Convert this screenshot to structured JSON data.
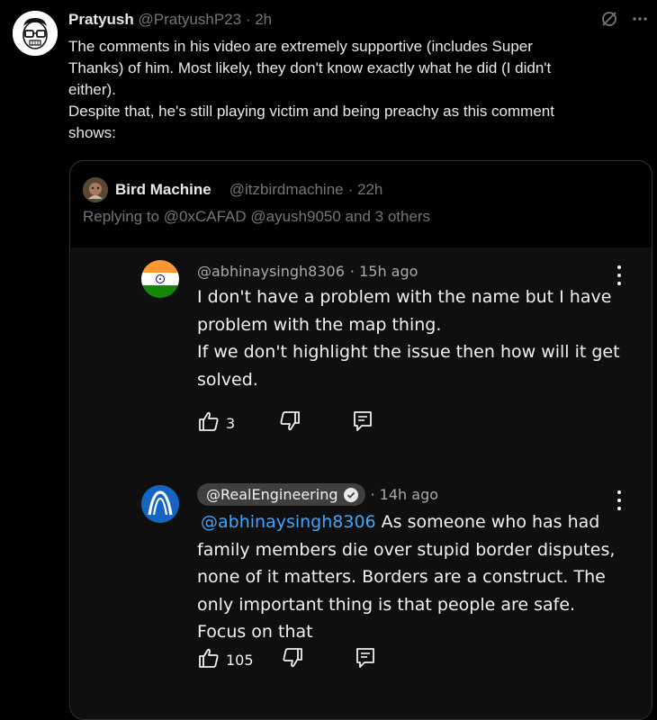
{
  "tweet": {
    "author_name": "Pratyush",
    "author_handle": "@PratyushP23",
    "time": "· 2h",
    "lines": [
      "The comments in his video are extremely supportive (includes Super",
      "Thanks) of him. Most likely, they don't know exactly what he did (I didn't",
      "either).",
      "Despite that, he's still playing victim and being preachy as this comment",
      "shows:"
    ],
    "more_icon": "more-horizontal-icon",
    "grok_icon": "grok-icon"
  },
  "quote": {
    "author_name": "Bird Machine",
    "author_handle": "@itzbirdmachine",
    "time": "· 22h",
    "replying_to": "Replying to @0xCAFAD @ayush9050 and 3 others"
  },
  "yt_comments": [
    {
      "author": "@abhinaysingh8306",
      "time": "· 15h ago",
      "lines": [
        "I don't have a problem with the name but I have",
        "problem with the map thing.",
        "If we don't highlight the issue then how will it get",
        "solved."
      ],
      "likes": "3"
    },
    {
      "author": "@RealEngineering",
      "time": "· 14h ago",
      "mention": "@abhinaysingh8306",
      "lines": [
        " As someone who has had",
        "family members die over stupid border disputes,",
        "none of it matters. Borders are a construct. The",
        "only important thing is that people are safe.",
        "Focus on that"
      ],
      "likes": "105"
    }
  ],
  "colors": {
    "background": "#000000",
    "text": "#e7e9ea",
    "muted": "#71767b",
    "yt_background": "#0f0f0f",
    "yt_link": "#3ea6ff"
  }
}
